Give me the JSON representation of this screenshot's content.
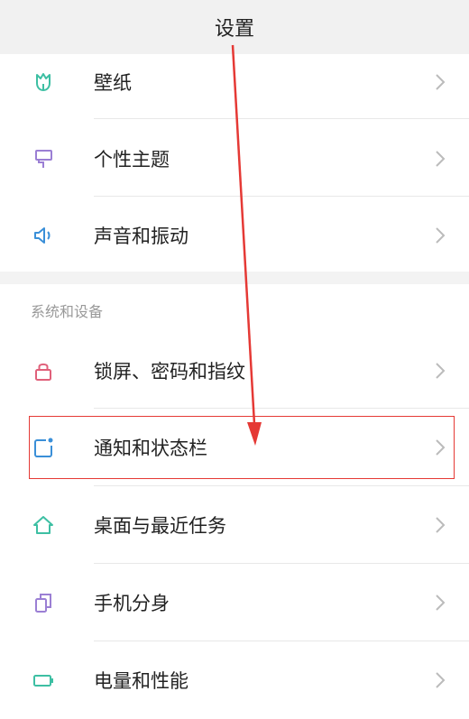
{
  "header": {
    "title": "设置"
  },
  "group1": [
    {
      "label": "壁纸",
      "icon": "tulip-icon"
    },
    {
      "label": "个性主题",
      "icon": "paint-roller-icon"
    },
    {
      "label": "声音和振动",
      "icon": "speaker-icon"
    }
  ],
  "section": {
    "title": "系统和设备"
  },
  "group2": [
    {
      "label": "锁屏、密码和指纹",
      "icon": "lock-icon"
    },
    {
      "label": "通知和状态栏",
      "icon": "notification-icon"
    },
    {
      "label": "桌面与最近任务",
      "icon": "home-icon"
    },
    {
      "label": "手机分身",
      "icon": "dual-app-icon"
    },
    {
      "label": "电量和性能",
      "icon": "battery-icon"
    }
  ],
  "colors": {
    "accent_teal": "#3dbfa3",
    "highlight_red": "#e53935",
    "lock_red": "#e0607a",
    "purple": "#9b7fd4",
    "blue": "#3a8fd8"
  }
}
